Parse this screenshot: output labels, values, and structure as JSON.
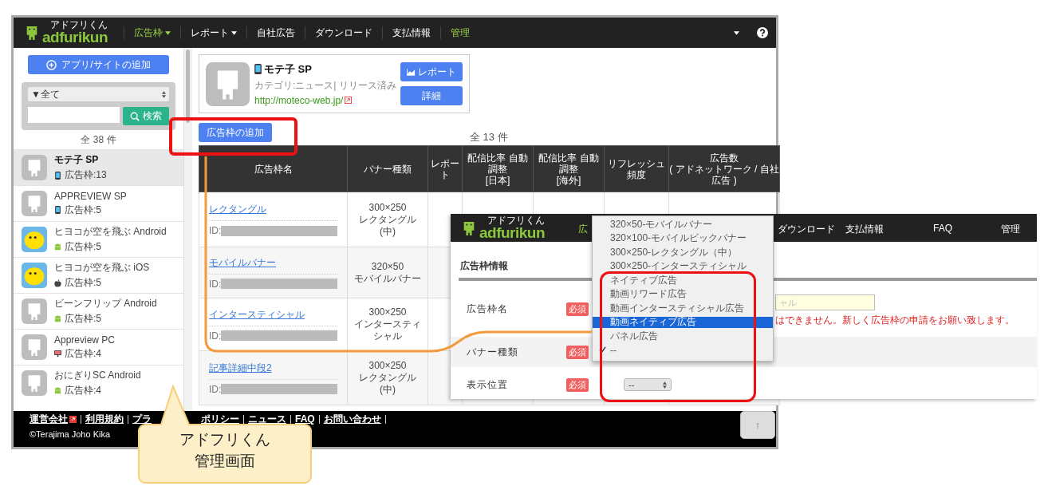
{
  "main_window": {
    "logo": {
      "text": "adfurikun",
      "kana": "アドフリくん"
    },
    "nav": [
      {
        "label": "広告枠",
        "dropdown": true,
        "active": true
      },
      {
        "label": "レポート",
        "dropdown": true,
        "active": false
      },
      {
        "label": "自社広告",
        "dropdown": false,
        "active": false
      },
      {
        "label": "ダウンロード",
        "dropdown": false,
        "active": false
      },
      {
        "label": "支払情報",
        "dropdown": false,
        "active": false
      },
      {
        "label": "管理",
        "dropdown": false,
        "active": true
      }
    ],
    "sidebar": {
      "add_button": "アプリ/サイトの追加",
      "filter": "▼全て",
      "search_button": "検索",
      "count": "全 38 件",
      "items": [
        {
          "name": "モテ子 SP",
          "kind": "mascot",
          "slots": {
            "kind": "phone",
            "text": "広告枠:13"
          },
          "selected": true
        },
        {
          "name": "APPREVIEW SP",
          "kind": "mascot",
          "slots": {
            "kind": "phone",
            "text": "広告枠:5"
          },
          "selected": false
        },
        {
          "name": "ヒヨコが空を飛ぶ Android",
          "kind": "chick",
          "slots": {
            "kind": "android",
            "text": "広告枠:5"
          },
          "selected": false
        },
        {
          "name": "ヒヨコが空を飛ぶ iOS",
          "kind": "chick",
          "slots": {
            "kind": "apple",
            "text": "広告枠:5"
          },
          "selected": false
        },
        {
          "name": "ビーンフリップ Android",
          "kind": "mascot",
          "slots": {
            "kind": "android",
            "text": "広告枠:5"
          },
          "selected": false
        },
        {
          "name": "Appreview PC",
          "kind": "mascot",
          "slots": {
            "kind": "monitor",
            "text": "広告枠:4"
          },
          "selected": false
        },
        {
          "name": "おにぎりSC Android",
          "kind": "mascot",
          "slots": {
            "kind": "android",
            "text": "広告枠:4"
          },
          "selected": false
        }
      ]
    },
    "app_card": {
      "name": "モテ子 SP",
      "meta": "カテゴリ:ニュース| リリース済み",
      "url": "http://moteco-web.jp/",
      "buttons": [
        "レポート",
        "詳細"
      ]
    },
    "add_slot_button": "広告枠の追加",
    "total": "全 13 件",
    "table": {
      "columns": [
        [
          "広告枠名"
        ],
        [
          "バナー種類"
        ],
        [
          "レポー",
          "ト"
        ],
        [
          "配信比率 自動",
          "調整",
          "[日本]"
        ],
        [
          "配信比率 自動",
          "調整",
          "[海外]"
        ],
        [
          "リフレッシュ",
          "頻度"
        ],
        [
          "広告数",
          "( アドネットワーク / 自社",
          "広告 )"
        ]
      ],
      "rows": [
        {
          "name": "レクタングル",
          "id_label": "ID:",
          "banner": [
            "300×250",
            "レクタングル",
            "(中)"
          ]
        },
        {
          "name": "モバイルバナー",
          "id_label": "ID:",
          "banner": [
            "320×50",
            "モバイルバナー"
          ]
        },
        {
          "name": "インタースティシャル",
          "id_label": "ID:",
          "banner": [
            "300×250",
            "インタースティ",
            "シャル"
          ]
        },
        {
          "name": "記事詳細中段2",
          "id_label": "ID:",
          "banner": [
            "300×250",
            "レクタングル",
            "(中)"
          ]
        }
      ]
    },
    "footer": {
      "links": [
        "運営会社",
        "利用規約",
        "プラ",
        "ポリシー",
        "ニュース",
        "FAQ",
        "お問い合わせ"
      ],
      "copyright": "©Terajima Joho Kika",
      "top_button": "↑"
    }
  },
  "overlay_window": {
    "logo": {
      "text": "adfurikun",
      "kana": "アドフリくん"
    },
    "nav": [
      {
        "label": "広",
        "active": true
      },
      {
        "label": "ダウンロード",
        "active": false
      },
      {
        "label": "支払情報",
        "active": false
      },
      {
        "label": "FAQ",
        "active": false
      },
      {
        "label": "管理",
        "active": false
      }
    ],
    "section_title": "広告枠情報",
    "fields": [
      {
        "label": "広告枠名",
        "required": "必須",
        "kind": "text",
        "placeholder": "ャル",
        "error": "はできません。新しく広告枠の申請をお願い致します。"
      },
      {
        "label": "バナー種類",
        "required": "必須",
        "kind": "empty"
      },
      {
        "label": "表示位置",
        "required": "必須",
        "kind": "select",
        "value": "--"
      }
    ]
  },
  "dropdown": {
    "options": [
      {
        "label": "320×50-モバイルバナー",
        "highlighted": false,
        "checked": false
      },
      {
        "label": "320×100-モバイルビックバナー",
        "highlighted": false,
        "checked": false
      },
      {
        "label": "300×250-レクタングル（中）",
        "highlighted": false,
        "checked": false
      },
      {
        "label": "300×250-インタースティシャル",
        "highlighted": false,
        "checked": false
      },
      {
        "label": "ネイティブ広告",
        "highlighted": false,
        "checked": false
      },
      {
        "label": "動画リワード広告",
        "highlighted": false,
        "checked": false
      },
      {
        "label": "動画インタースティシャル広告",
        "highlighted": false,
        "checked": false
      },
      {
        "label": "動画ネイティブ広告",
        "highlighted": true,
        "checked": false
      },
      {
        "label": "パネル広告",
        "highlighted": false,
        "checked": false
      },
      {
        "label": "--",
        "highlighted": false,
        "checked": true
      }
    ]
  },
  "callout": {
    "lines": [
      "アドフリくん",
      "管理画面"
    ]
  }
}
